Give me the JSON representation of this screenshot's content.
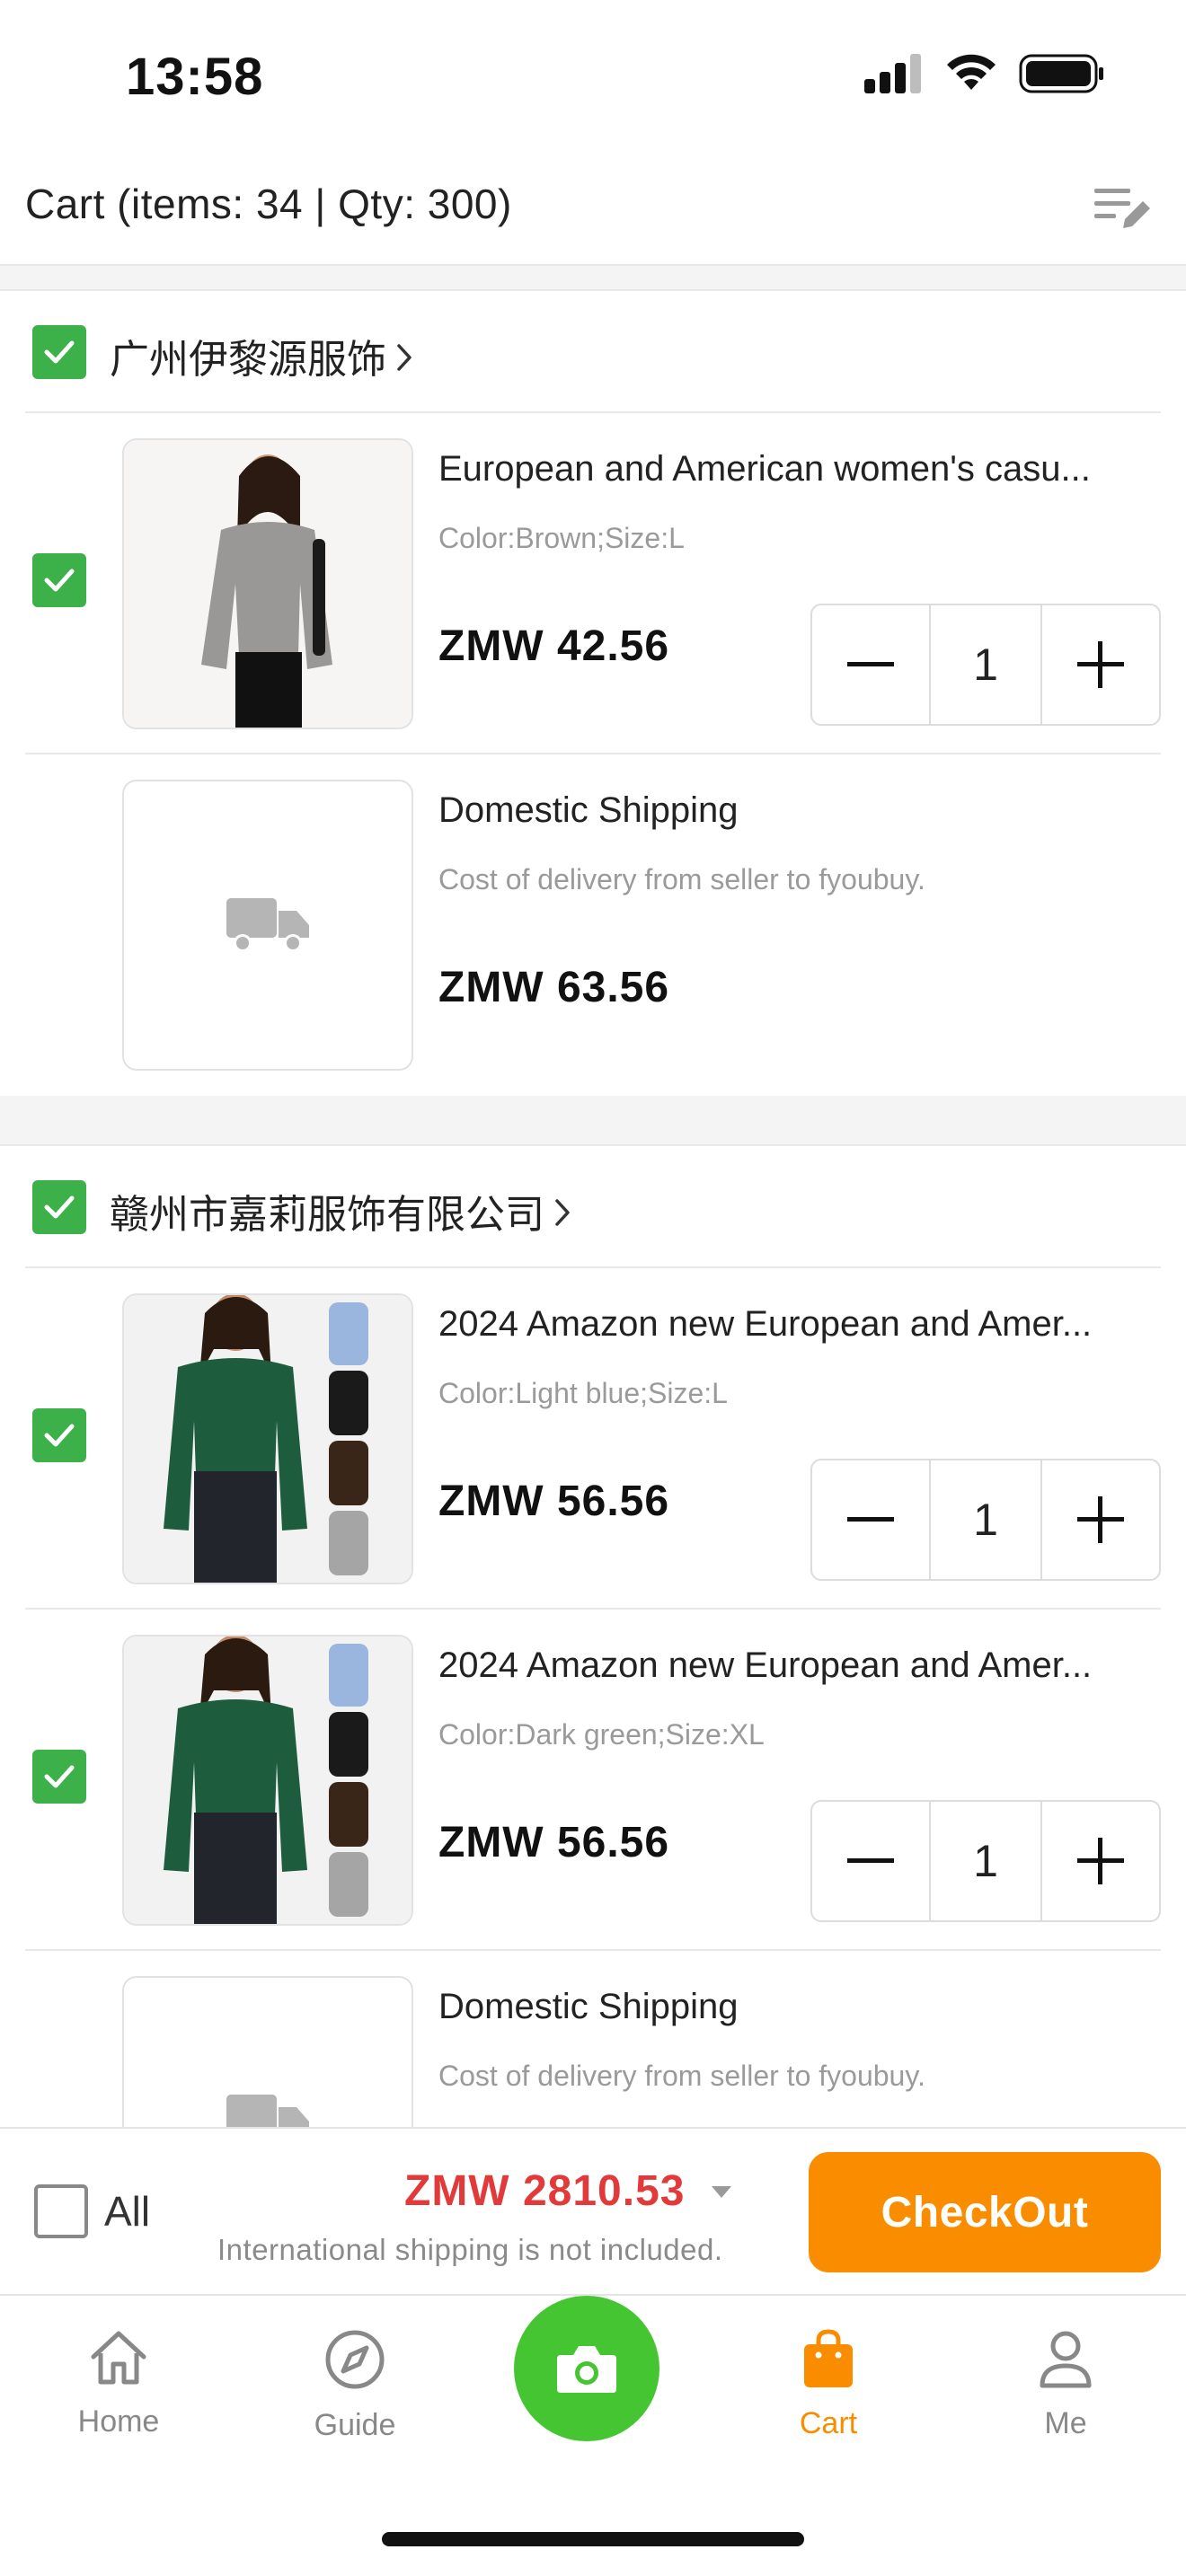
{
  "status": {
    "time": "13:58"
  },
  "header": {
    "title": "Cart (items: 34 | Qty: 300)"
  },
  "sellers": [
    {
      "name": "广州伊黎源服饰",
      "item": {
        "title": "European and American women's casu...",
        "variant": "Color:Brown;Size:L",
        "price": "ZMW 42.56",
        "qty": "1"
      },
      "shipping": {
        "title": "Domestic Shipping",
        "desc": "Cost of delivery from seller to fyoubuy.",
        "price": "ZMW 63.56"
      }
    },
    {
      "name": "赣州市嘉莉服饰有限公司",
      "items": [
        {
          "title": "2024 Amazon new European and Amer...",
          "variant": "Color:Light blue;Size:L",
          "price": "ZMW 56.56",
          "qty": "1"
        },
        {
          "title": "2024 Amazon new European and Amer...",
          "variant": "Color:Dark green;Size:XL",
          "price": "ZMW 56.56",
          "qty": "1"
        }
      ],
      "shipping": {
        "title": "Domestic Shipping",
        "desc": "Cost of delivery from seller to fyoubuy."
      }
    }
  ],
  "checkout": {
    "all_label": "All",
    "total": "ZMW 2810.53",
    "note": "International shipping is not included.",
    "button": "CheckOut"
  },
  "tabs": {
    "home": "Home",
    "guide": "Guide",
    "cart": "Cart",
    "me": "Me"
  },
  "colors": {
    "accent": "#fa8c00",
    "check_green": "#3cb14a",
    "camera_green": "#45c531",
    "price_red": "#e23a3a"
  }
}
